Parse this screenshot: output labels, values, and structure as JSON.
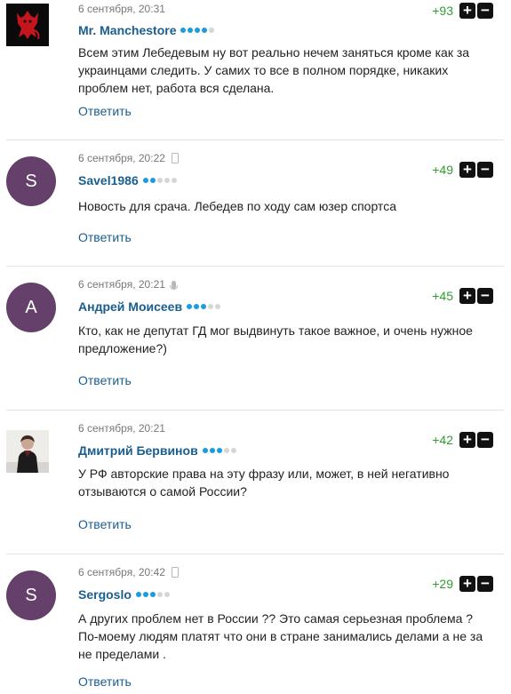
{
  "accent": "#1a5e8e",
  "comments": [
    {
      "date": "6 сентября, 20:31",
      "author": "Mr. Manchestore",
      "author_level": 4,
      "score": "+93",
      "text": "Всем этим Лебедевым ну вот реально нечем заняться кроме как за украинцами следить. У самих то все в полном порядке, никаких проблем нет, работа вся сделана.",
      "reply": "Ответить",
      "avatar": "red-devil-logo-icon"
    },
    {
      "date": "6 сентября, 20:22",
      "device": "phone-icon",
      "author": "Savel1986",
      "author_level": 2,
      "score": "+49",
      "text": "Новость для срача. Лебедев по ходу сам юзер спортса",
      "reply": "Ответить",
      "avatar_letter": "S"
    },
    {
      "date": "6 сентября, 20:21",
      "device": "microphone-icon",
      "author": "Андрей Моисеев",
      "author_level": 3,
      "score": "+45",
      "text": "Кто, как не депутат ГД мог выдвинуть такое важное, и очень нужное предложение?)",
      "reply": "Ответить",
      "avatar_letter": "А"
    },
    {
      "date": "6 сентября, 20:21",
      "author": "Дмитрий Бервинов",
      "author_level": 3,
      "score": "+42",
      "text": "У РФ авторские права на эту фразу или, может, в ней негативно отзываются о самой России?",
      "reply": "Ответить",
      "avatar": "user-photo"
    },
    {
      "date": "6 сентября, 20:42",
      "device": "phone-icon",
      "author": "Sergoslo",
      "author_level": 3,
      "score": "+29",
      "text": "А других проблем нет в России ?? Это самая серьезная проблема ? По-моему людям платят что они в стране занимались делами а не за не пределами .",
      "reply": "Ответить",
      "avatar_letter": "S"
    }
  ],
  "vote_plus": "+",
  "vote_minus": "−"
}
